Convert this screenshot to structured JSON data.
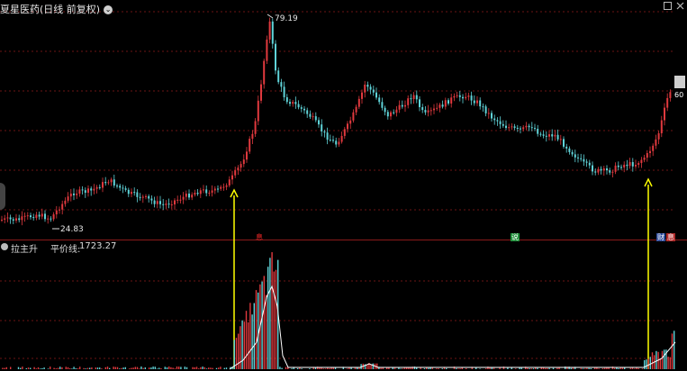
{
  "title": {
    "text": "夏星医药(日线 前复权)",
    "icon": "chevron-down-icon"
  },
  "price_labels": {
    "high": "79.19",
    "low": "24.83"
  },
  "right_axis_label": "60",
  "sub_panel": {
    "indicator_name": "拉主升",
    "metric_label": "平价线:",
    "metric_value": "1723.27"
  },
  "markers": [
    {
      "text": "息",
      "color": "#ff2a2a",
      "bg": ""
    },
    {
      "text": "说",
      "color": "#ffffff",
      "bg": "#1f8f3a"
    },
    {
      "text": "财",
      "color": "#ffffff",
      "bg": "#2b4a9a"
    },
    {
      "text": "息",
      "color": "#ffffff",
      "bg": "#b02a2a"
    }
  ],
  "colors": {
    "up": "#e0393e",
    "down": "#5fd3d8",
    "arrow": "#ffff00",
    "grid": "#6b1414",
    "volume_line": "#ffffff"
  },
  "chart_data": {
    "type": "candlestick",
    "high_value": 79.19,
    "low_value": 24.83,
    "arrows_at_index": [
      52,
      148
    ]
  }
}
